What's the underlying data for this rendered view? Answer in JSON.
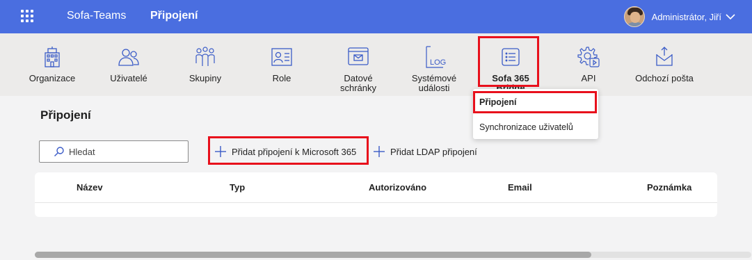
{
  "header": {
    "app_name": "Sofa-Teams",
    "page_name": "Připojení",
    "user_name": "Administrátor, Jiří",
    "accent_color": "#4a6ee0"
  },
  "toolbar": {
    "items": [
      {
        "label": "Organizace",
        "icon": "building-icon"
      },
      {
        "label": "Uživatelé",
        "icon": "users-icon"
      },
      {
        "label": "Skupiny",
        "icon": "groups-icon"
      },
      {
        "label": "Role",
        "icon": "id-card-icon"
      },
      {
        "label": "Datové\nschránky",
        "icon": "mailbox-icon"
      },
      {
        "label": "Systémové\nudálosti",
        "icon": "log-icon"
      },
      {
        "label": "Sofa 365\nBridge",
        "icon": "list-icon",
        "active": true
      },
      {
        "label": "API",
        "icon": "gear-play-icon"
      },
      {
        "label": "Odchozí pošta",
        "icon": "outbox-icon"
      }
    ]
  },
  "dropdown": {
    "items": [
      "Připojení",
      "Synchronizace uživatelů"
    ],
    "selected": "Připojení"
  },
  "main": {
    "title": "Připojení",
    "search_placeholder": "Hledat",
    "actions": {
      "add_m365": "Přidat připojení k Microsoft 365",
      "add_ldap": "Přidat LDAP připojení"
    },
    "table": {
      "columns": [
        "Název",
        "Typ",
        "Autorizováno",
        "Email",
        "Poznámka"
      ],
      "rows": []
    }
  },
  "highlight_color": "#e8101c"
}
